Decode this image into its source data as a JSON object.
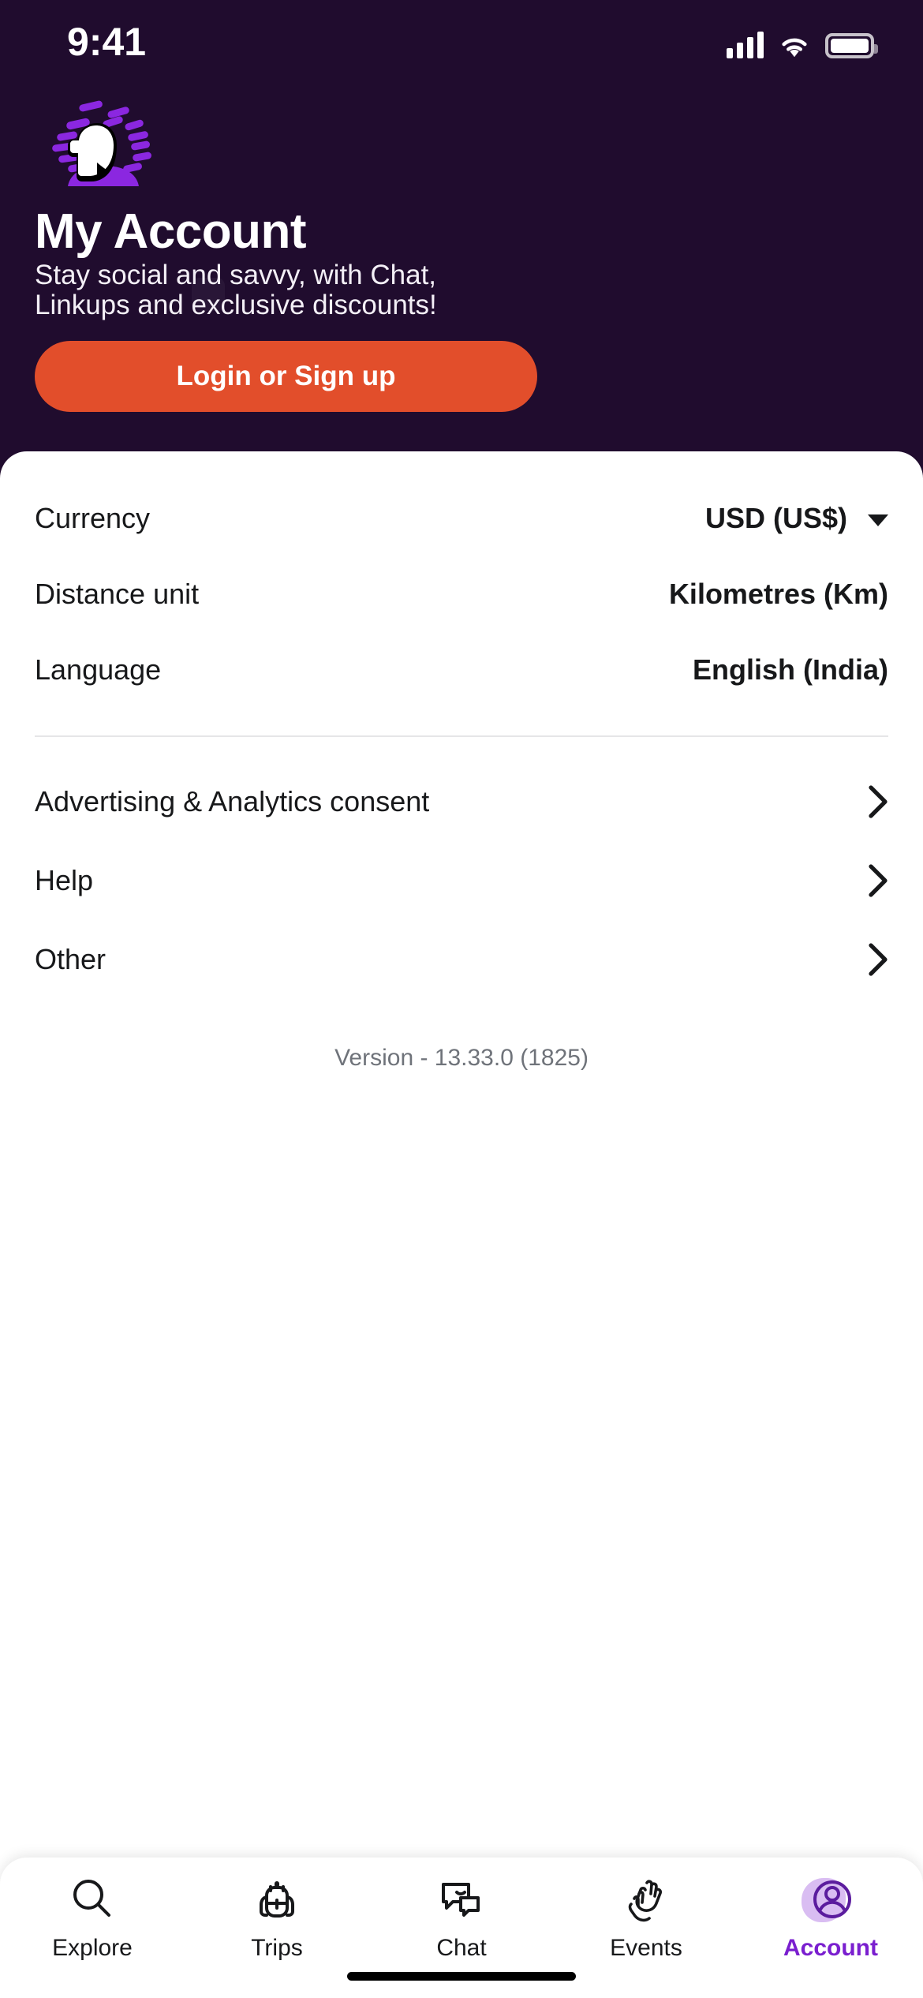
{
  "status_bar": {
    "time": "9:41",
    "signal_icon": "cellular-bars-icon",
    "wifi_icon": "wifi-icon",
    "battery_icon": "battery-icon"
  },
  "hero": {
    "logo_icon": "hostelworld-head-logo-icon",
    "title": "My Account",
    "subtitle": "Stay social and savvy, with Chat, Linkups and exclusive discounts!",
    "cta_label": "Login or Sign up",
    "background_color": "#200C2E",
    "cta_color": "#E24E2B"
  },
  "settings": {
    "rows": [
      {
        "label": "Currency",
        "value": "USD (US$)",
        "has_caret": true
      },
      {
        "label": "Distance unit",
        "value": "Kilometres (Km)",
        "has_caret": false
      },
      {
        "label": "Language",
        "value": "English (India)",
        "has_caret": false
      }
    ],
    "links": [
      {
        "label": "Advertising & Analytics consent",
        "icon": "chevron-right-icon"
      },
      {
        "label": "Help",
        "icon": "chevron-right-icon"
      },
      {
        "label": "Other",
        "icon": "chevron-right-icon"
      }
    ],
    "version": "Version - 13.33.0 (1825)"
  },
  "tabbar": {
    "active_color": "#7A1FCF",
    "items": [
      {
        "label": "Explore",
        "icon": "search-icon",
        "active": false
      },
      {
        "label": "Trips",
        "icon": "backpack-icon",
        "active": false
      },
      {
        "label": "Chat",
        "icon": "chat-bubbles-icon",
        "active": false
      },
      {
        "label": "Events",
        "icon": "clapping-hands-icon",
        "active": false
      },
      {
        "label": "Account",
        "icon": "user-avatar-icon",
        "active": true
      }
    ]
  }
}
